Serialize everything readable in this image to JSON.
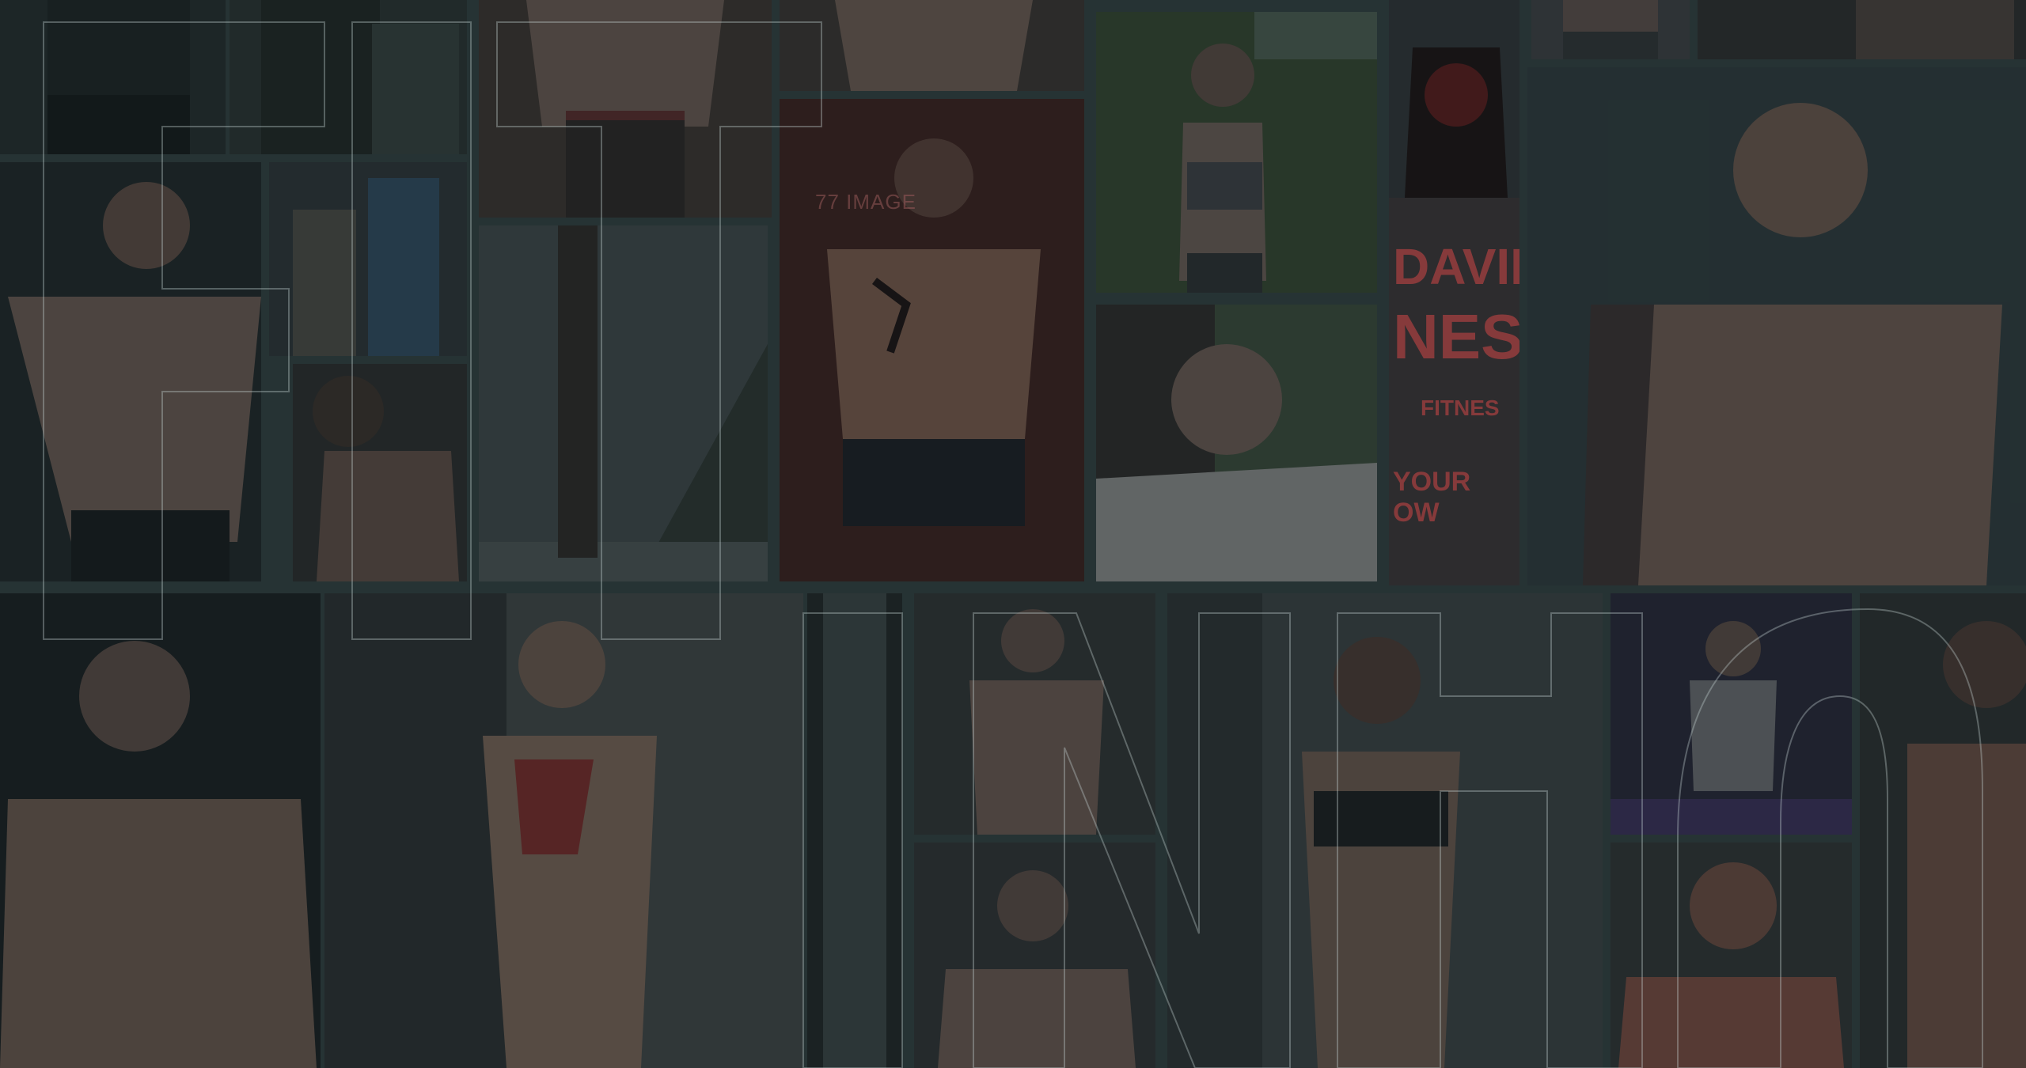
{
  "collage": {
    "photos": [
      {
        "name": "photo-man-shirtless-shorts",
        "subject": "shirtless man, torso",
        "tone": "#262f2f"
      },
      {
        "name": "photo-man-dark-shirt",
        "subject": "man in dark shirt",
        "tone": "#2a3331"
      },
      {
        "name": "photo-man-abs-wood",
        "subject": "shirtless man abs on wood floor",
        "tone": "#3a3530"
      },
      {
        "name": "photo-man-abs-top",
        "subject": "shirtless man torso",
        "tone": "#3b3632"
      },
      {
        "name": "photo-woman-outdoors",
        "subject": "woman in sports bra outdoors",
        "tone": "#35452f"
      },
      {
        "name": "photo-brand-logo",
        "subject": "fitness brand logo shirt",
        "tone": "#3a2a2a"
      },
      {
        "name": "photo-woman-torso-top",
        "subject": "woman torso",
        "tone": "#3d4042"
      },
      {
        "name": "photo-man-torso-top",
        "subject": "man torso",
        "tone": "#2f2f2f"
      },
      {
        "name": "photo-man-superman",
        "subject": "man flexing with superman tattoo",
        "tone": "#202829"
      },
      {
        "name": "photo-two-men-gym",
        "subject": "two men at gym",
        "tone": "#2c3537"
      },
      {
        "name": "photo-man-profile",
        "subject": "man in profile",
        "tone": "#2a2d2c"
      },
      {
        "name": "photo-handstand",
        "subject": "handstand on beach",
        "tone": "#3b4546"
      },
      {
        "name": "photo-man-tribal-tattoo",
        "subject": "man with tribal tattoo red background",
        "tone": "#3a1f1c"
      },
      {
        "name": "photo-woman-selfie",
        "subject": "woman selfie in hoodie",
        "tone": "#4a4d4a"
      },
      {
        "name": "photo-man-smiling",
        "subject": "smiling shirtless man",
        "tone": "#2e3a3c"
      },
      {
        "name": "photo-man-studio",
        "subject": "shirtless man studio",
        "tone": "#181f20"
      },
      {
        "name": "photo-woman-red-bra",
        "subject": "woman red sports bra mirror selfie",
        "tone": "#3a3f40"
      },
      {
        "name": "photo-window",
        "subject": "window frame",
        "tone": "#3a4444"
      },
      {
        "name": "photo-man-mirror-selfie",
        "subject": "man mirror selfie abs",
        "tone": "#2e3334"
      },
      {
        "name": "photo-man-mirror-selfie-2",
        "subject": "man mirror selfie",
        "tone": "#2f3234"
      },
      {
        "name": "photo-woman-black-bra",
        "subject": "woman black sports bra",
        "tone": "#3c4344"
      },
      {
        "name": "photo-man-gym-lifting",
        "subject": "man lifting in gym",
        "tone": "#2a2a3a"
      },
      {
        "name": "photo-bald-man",
        "subject": "bald man flexing",
        "tone": "#3a2e2c"
      },
      {
        "name": "photo-man-cap",
        "subject": "man in cap shirtless",
        "tone": "#2c2a28"
      }
    ],
    "photo_texts": {
      "tattoo_text": "77 IMAGE",
      "brand_line1": "DAVID",
      "brand_line2": "NESB",
      "brand_line3": "FITNES",
      "brand_line4": "YOUR OW"
    },
    "outline_word": "FIT INN?",
    "colors": {
      "background": "#30403f",
      "overlay": "#141e20",
      "outline": "#c8d7d7",
      "brand_red": "#e65050"
    }
  }
}
